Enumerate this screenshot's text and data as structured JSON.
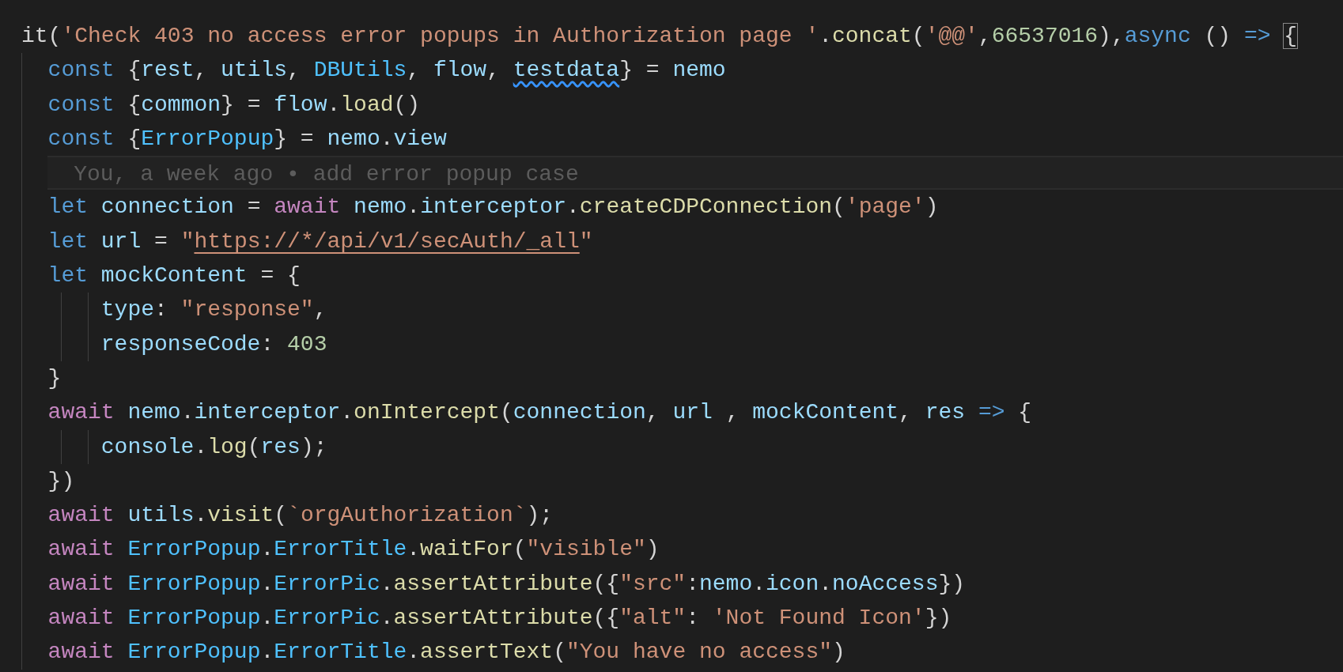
{
  "lines": [
    {
      "kind": "code",
      "tokens": [
        {
          "text": "it(",
          "kind": "plain"
        },
        {
          "text": "'Check 403 no access error popups in Authorization page '",
          "kind": "str"
        },
        {
          "text": ".",
          "kind": "plain"
        },
        {
          "text": "concat",
          "kind": "fn"
        },
        {
          "text": "(",
          "kind": "plain"
        },
        {
          "text": "'@@'",
          "kind": "str"
        },
        {
          "text": ",",
          "kind": "plain"
        },
        {
          "text": "66537016",
          "kind": "num"
        },
        {
          "text": "),",
          "kind": "plain"
        },
        {
          "text": "async",
          "kind": "kw"
        },
        {
          "text": " () ",
          "kind": "plain"
        },
        {
          "text": "=> ",
          "kind": "kw"
        },
        {
          "text": "{",
          "kind": "plain",
          "bracket_match": true
        }
      ],
      "children": [
        {
          "kind": "code",
          "tokens": [
            {
              "text": "const",
              "kind": "kw"
            },
            {
              "text": " {",
              "kind": "plain"
            },
            {
              "text": "rest",
              "kind": "var"
            },
            {
              "text": ", ",
              "kind": "plain"
            },
            {
              "text": "utils",
              "kind": "var"
            },
            {
              "text": ", ",
              "kind": "plain"
            },
            {
              "text": "DBUtils",
              "kind": "const"
            },
            {
              "text": ", ",
              "kind": "plain"
            },
            {
              "text": "flow",
              "kind": "var"
            },
            {
              "text": ", ",
              "kind": "plain"
            },
            {
              "text": "testdata",
              "kind": "var",
              "squiggle": true
            },
            {
              "text": "} = ",
              "kind": "plain"
            },
            {
              "text": "nemo",
              "kind": "var"
            }
          ]
        },
        {
          "kind": "code",
          "tokens": [
            {
              "text": "const",
              "kind": "kw"
            },
            {
              "text": " {",
              "kind": "plain"
            },
            {
              "text": "common",
              "kind": "var"
            },
            {
              "text": "} = ",
              "kind": "plain"
            },
            {
              "text": "flow",
              "kind": "var"
            },
            {
              "text": ".",
              "kind": "plain"
            },
            {
              "text": "load",
              "kind": "fn"
            },
            {
              "text": "()",
              "kind": "plain"
            }
          ]
        },
        {
          "kind": "code",
          "tokens": [
            {
              "text": "const",
              "kind": "kw"
            },
            {
              "text": " {",
              "kind": "plain"
            },
            {
              "text": "ErrorPopup",
              "kind": "const"
            },
            {
              "text": "} = ",
              "kind": "plain"
            },
            {
              "text": "nemo",
              "kind": "var"
            },
            {
              "text": ".",
              "kind": "plain"
            },
            {
              "text": "view",
              "kind": "var"
            }
          ]
        },
        {
          "kind": "blame",
          "text": "You, a week ago • add error popup case"
        },
        {
          "kind": "code",
          "tokens": [
            {
              "text": "let ",
              "kind": "kw"
            },
            {
              "text": "connection",
              "kind": "var"
            },
            {
              "text": " = ",
              "kind": "plain"
            },
            {
              "text": "await ",
              "kind": "ctrl"
            },
            {
              "text": "nemo",
              "kind": "var"
            },
            {
              "text": ".",
              "kind": "plain"
            },
            {
              "text": "interceptor",
              "kind": "var"
            },
            {
              "text": ".",
              "kind": "plain"
            },
            {
              "text": "createCDPConnection",
              "kind": "fn"
            },
            {
              "text": "(",
              "kind": "plain"
            },
            {
              "text": "'page'",
              "kind": "str"
            },
            {
              "text": ")",
              "kind": "plain"
            }
          ]
        },
        {
          "kind": "code",
          "tokens": [
            {
              "text": "let ",
              "kind": "kw"
            },
            {
              "text": "url",
              "kind": "var"
            },
            {
              "text": " = ",
              "kind": "plain"
            },
            {
              "text": "\"",
              "kind": "str"
            },
            {
              "text": "https://*/api/v1/secAuth/_all",
              "kind": "str",
              "link": true
            },
            {
              "text": "\"",
              "kind": "str"
            }
          ]
        },
        {
          "kind": "code",
          "tokens": [
            {
              "text": "let ",
              "kind": "kw"
            },
            {
              "text": "mockContent",
              "kind": "var"
            },
            {
              "text": " = {",
              "kind": "plain"
            }
          ],
          "children": [
            {
              "kind": "code",
              "tokens": [
                {
                  "text": "type",
                  "kind": "var"
                },
                {
                  "text": ": ",
                  "kind": "plain"
                },
                {
                  "text": "\"response\"",
                  "kind": "str"
                },
                {
                  "text": ",",
                  "kind": "plain"
                }
              ]
            },
            {
              "kind": "code",
              "tokens": [
                {
                  "text": "responseCode",
                  "kind": "var"
                },
                {
                  "text": ": ",
                  "kind": "plain"
                },
                {
                  "text": "403",
                  "kind": "num"
                }
              ]
            }
          ]
        },
        {
          "kind": "code",
          "tokens": [
            {
              "text": "}",
              "kind": "plain"
            }
          ]
        },
        {
          "kind": "code",
          "tokens": [
            {
              "text": "await ",
              "kind": "ctrl"
            },
            {
              "text": "nemo",
              "kind": "var"
            },
            {
              "text": ".",
              "kind": "plain"
            },
            {
              "text": "interceptor",
              "kind": "var"
            },
            {
              "text": ".",
              "kind": "plain"
            },
            {
              "text": "onIntercept",
              "kind": "fn"
            },
            {
              "text": "(",
              "kind": "plain"
            },
            {
              "text": "connection",
              "kind": "var"
            },
            {
              "text": ", ",
              "kind": "plain"
            },
            {
              "text": "url",
              "kind": "var"
            },
            {
              "text": " , ",
              "kind": "plain"
            },
            {
              "text": "mockContent",
              "kind": "var"
            },
            {
              "text": ", ",
              "kind": "plain"
            },
            {
              "text": "res ",
              "kind": "var"
            },
            {
              "text": "=>",
              "kind": "kw"
            },
            {
              "text": " {",
              "kind": "plain"
            }
          ],
          "children": [
            {
              "kind": "code",
              "tokens": [
                {
                  "text": "console",
                  "kind": "var"
                },
                {
                  "text": ".",
                  "kind": "plain"
                },
                {
                  "text": "log",
                  "kind": "fn"
                },
                {
                  "text": "(",
                  "kind": "plain"
                },
                {
                  "text": "res",
                  "kind": "var"
                },
                {
                  "text": ");",
                  "kind": "plain"
                }
              ]
            }
          ]
        },
        {
          "kind": "code",
          "tokens": [
            {
              "text": "})",
              "kind": "plain"
            }
          ]
        },
        {
          "kind": "code",
          "tokens": [
            {
              "text": "await ",
              "kind": "ctrl"
            },
            {
              "text": "utils",
              "kind": "var"
            },
            {
              "text": ".",
              "kind": "plain"
            },
            {
              "text": "visit",
              "kind": "fn"
            },
            {
              "text": "(",
              "kind": "plain"
            },
            {
              "text": "`orgAuthorization`",
              "kind": "str"
            },
            {
              "text": ");",
              "kind": "plain"
            }
          ]
        },
        {
          "kind": "code",
          "tokens": [
            {
              "text": "await ",
              "kind": "ctrl"
            },
            {
              "text": "ErrorPopup",
              "kind": "const"
            },
            {
              "text": ".",
              "kind": "plain"
            },
            {
              "text": "ErrorTitle",
              "kind": "const"
            },
            {
              "text": ".",
              "kind": "plain"
            },
            {
              "text": "waitFor",
              "kind": "fn"
            },
            {
              "text": "(",
              "kind": "plain"
            },
            {
              "text": "\"visible\"",
              "kind": "str"
            },
            {
              "text": ")",
              "kind": "plain"
            }
          ]
        },
        {
          "kind": "code",
          "tokens": [
            {
              "text": "await ",
              "kind": "ctrl"
            },
            {
              "text": "ErrorPopup",
              "kind": "const"
            },
            {
              "text": ".",
              "kind": "plain"
            },
            {
              "text": "ErrorPic",
              "kind": "const"
            },
            {
              "text": ".",
              "kind": "plain"
            },
            {
              "text": "assertAttribute",
              "kind": "fn"
            },
            {
              "text": "({",
              "kind": "plain"
            },
            {
              "text": "\"src\"",
              "kind": "str"
            },
            {
              "text": ":",
              "kind": "plain"
            },
            {
              "text": "nemo",
              "kind": "var"
            },
            {
              "text": ".",
              "kind": "plain"
            },
            {
              "text": "icon",
              "kind": "var"
            },
            {
              "text": ".",
              "kind": "plain"
            },
            {
              "text": "noAccess",
              "kind": "var"
            },
            {
              "text": "})",
              "kind": "plain"
            }
          ]
        },
        {
          "kind": "code",
          "tokens": [
            {
              "text": "await ",
              "kind": "ctrl"
            },
            {
              "text": "ErrorPopup",
              "kind": "const"
            },
            {
              "text": ".",
              "kind": "plain"
            },
            {
              "text": "ErrorPic",
              "kind": "const"
            },
            {
              "text": ".",
              "kind": "plain"
            },
            {
              "text": "assertAttribute",
              "kind": "fn"
            },
            {
              "text": "({",
              "kind": "plain"
            },
            {
              "text": "\"alt\"",
              "kind": "str"
            },
            {
              "text": ": ",
              "kind": "plain"
            },
            {
              "text": "'Not Found Icon'",
              "kind": "str"
            },
            {
              "text": "})",
              "kind": "plain"
            }
          ]
        },
        {
          "kind": "code",
          "tokens": [
            {
              "text": "await ",
              "kind": "ctrl"
            },
            {
              "text": "ErrorPopup",
              "kind": "const"
            },
            {
              "text": ".",
              "kind": "plain"
            },
            {
              "text": "ErrorTitle",
              "kind": "const"
            },
            {
              "text": ".",
              "kind": "plain"
            },
            {
              "text": "assertText",
              "kind": "fn"
            },
            {
              "text": "(",
              "kind": "plain"
            },
            {
              "text": "\"You have no access\"",
              "kind": "str"
            },
            {
              "text": ")",
              "kind": "plain"
            }
          ]
        }
      ]
    }
  ]
}
